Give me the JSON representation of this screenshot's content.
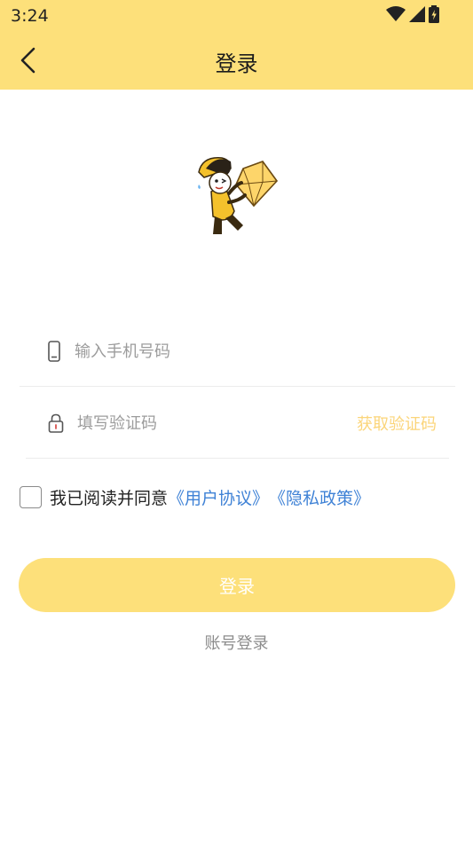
{
  "status_bar": {
    "time": "3:24"
  },
  "header": {
    "title": "登录",
    "back_icon": "chevron-left-icon"
  },
  "form": {
    "phone": {
      "placeholder": "输入手机号码",
      "value": "",
      "icon": "mobile-phone-icon"
    },
    "code": {
      "placeholder": "填写验证码",
      "value": "",
      "icon": "lock-icon",
      "get_code_label": "获取验证码"
    }
  },
  "agreement": {
    "checked": false,
    "text": "我已阅读并同意",
    "user_agreement": "《用户协议》",
    "privacy_policy": "《隐私政策》"
  },
  "actions": {
    "login_label": "登录",
    "account_login_label": "账号登录"
  },
  "colors": {
    "brand_yellow": "#fde07a",
    "link_blue": "#3f82d6",
    "get_code_text": "#fbd57a"
  }
}
